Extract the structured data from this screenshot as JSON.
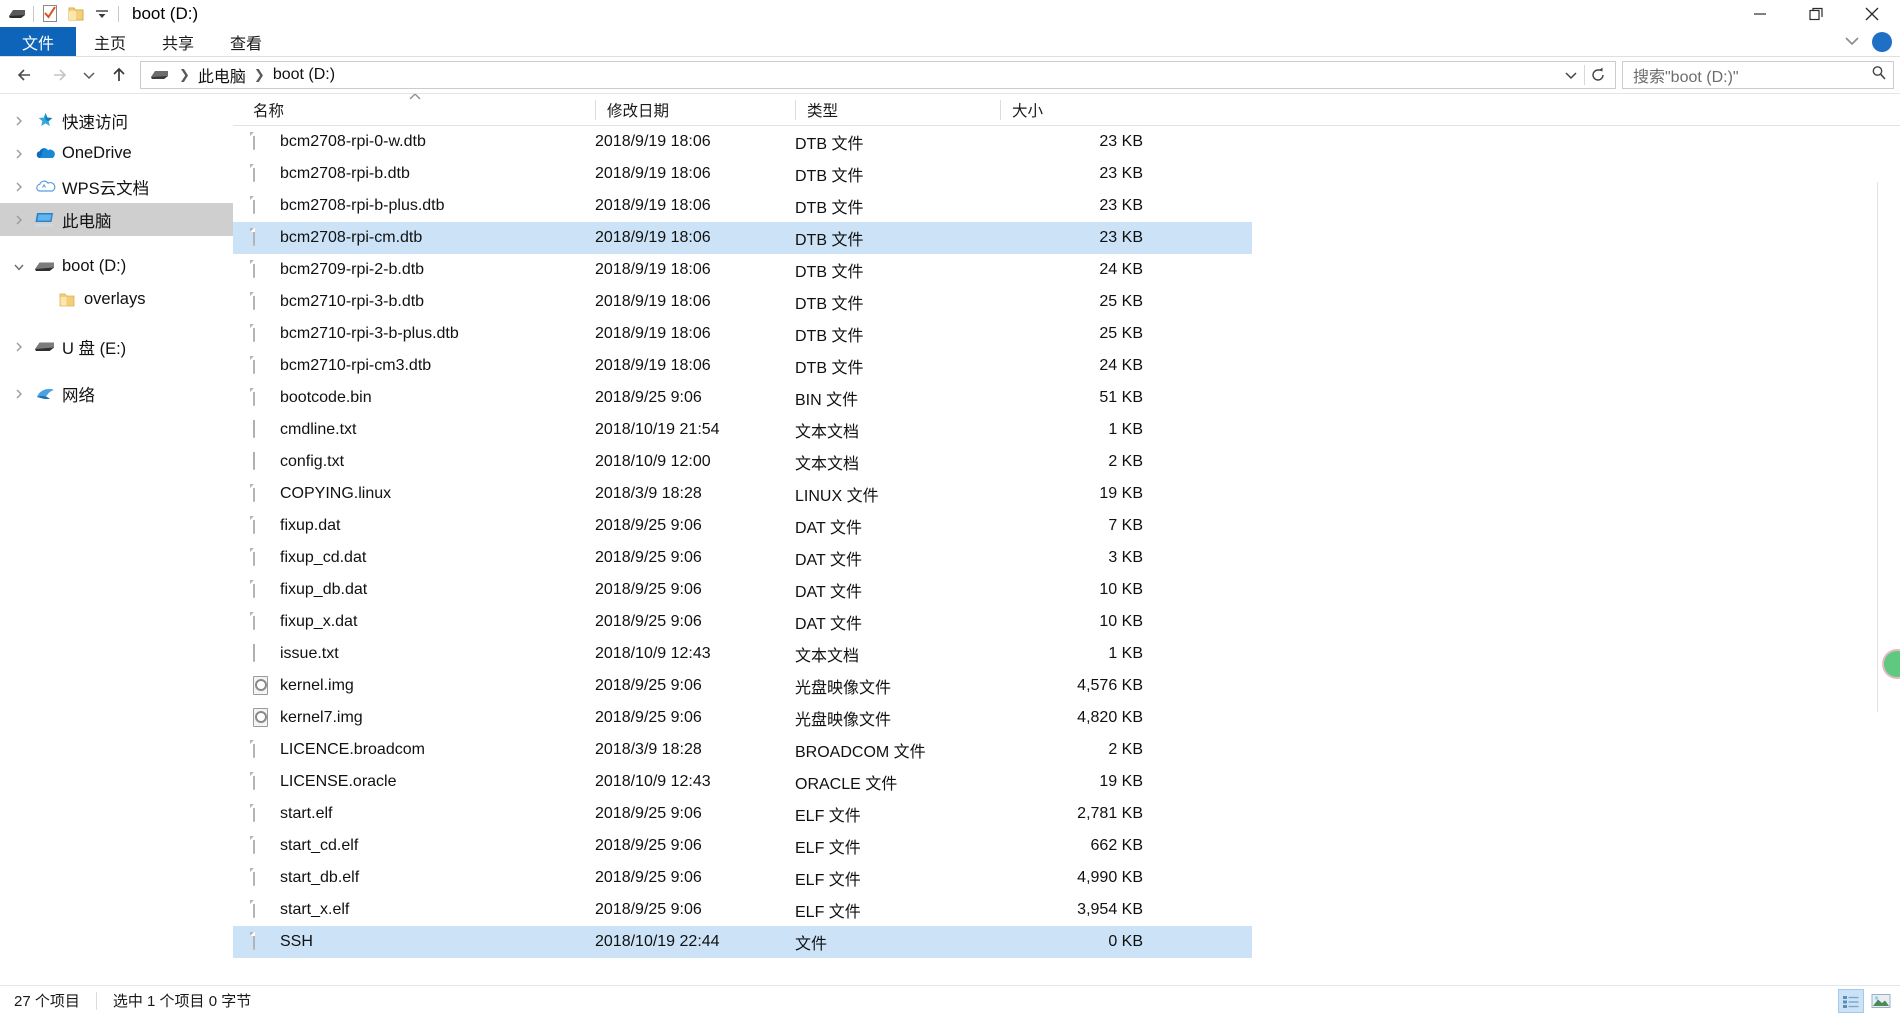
{
  "window": {
    "title": "boot (D:)",
    "quick_access_icons": [
      "drive-icon",
      "properties-icon",
      "new-folder-icon",
      "customize-dropdown-icon"
    ],
    "controls": {
      "minimize": "minimize-icon",
      "maximize": "maximize-icon",
      "close": "close-icon"
    }
  },
  "ribbon": {
    "tabs": [
      {
        "label": "文件",
        "active": true
      },
      {
        "label": "主页",
        "active": false
      },
      {
        "label": "共享",
        "active": false
      },
      {
        "label": "查看",
        "active": false
      }
    ],
    "collapse_icon": "chevron-down-icon",
    "help_icon": "help-circle-icon"
  },
  "address": {
    "back_icon": "arrow-left-icon",
    "forward_icon": "arrow-right-icon",
    "recent_icon": "chevron-down-icon",
    "up_icon": "arrow-up-icon",
    "drive_icon": "drive-icon",
    "breadcrumbs": [
      "此电脑",
      "boot (D:)"
    ],
    "dropdown_icon": "chevron-down-icon",
    "refresh_icon": "refresh-icon"
  },
  "search": {
    "placeholder": "搜索\"boot (D:)\"",
    "icon": "search-icon"
  },
  "sidebar": {
    "items": [
      {
        "label": "快速访问",
        "icon": "star-pin-icon",
        "expander": "chevron-right",
        "indent": 0,
        "selected": false
      },
      {
        "label": "OneDrive",
        "icon": "onedrive-cloud-icon",
        "expander": "chevron-right",
        "indent": 0,
        "selected": false
      },
      {
        "label": "WPS云文档",
        "icon": "wps-cloud-icon",
        "expander": "chevron-right",
        "indent": 0,
        "selected": false
      },
      {
        "label": "此电脑",
        "icon": "this-pc-icon",
        "expander": "chevron-right",
        "indent": 0,
        "selected": true
      },
      {
        "label": "boot (D:)",
        "icon": "drive-icon",
        "expander": "chevron-down",
        "indent": 0,
        "selected": false
      },
      {
        "label": "overlays",
        "icon": "folder-icon",
        "expander": "none",
        "indent": 1,
        "selected": false
      },
      {
        "label": "U 盘 (E:)",
        "icon": "drive-icon",
        "expander": "chevron-right",
        "indent": 0,
        "selected": false
      },
      {
        "label": "网络",
        "icon": "network-icon",
        "expander": "chevron-right",
        "indent": 0,
        "selected": false
      }
    ]
  },
  "file_list": {
    "columns": [
      "名称",
      "修改日期",
      "类型",
      "大小"
    ],
    "sort_column": "名称",
    "sort_direction": "ascending",
    "rows": [
      {
        "name": "bcm2708-rpi-0-w.dtb",
        "date": "2018/9/19 18:06",
        "type": "DTB 文件",
        "size": "23 KB",
        "icon": "file-icon",
        "selected": false
      },
      {
        "name": "bcm2708-rpi-b.dtb",
        "date": "2018/9/19 18:06",
        "type": "DTB 文件",
        "size": "23 KB",
        "icon": "file-icon",
        "selected": false
      },
      {
        "name": "bcm2708-rpi-b-plus.dtb",
        "date": "2018/9/19 18:06",
        "type": "DTB 文件",
        "size": "23 KB",
        "icon": "file-icon",
        "selected": false
      },
      {
        "name": "bcm2708-rpi-cm.dtb",
        "date": "2018/9/19 18:06",
        "type": "DTB 文件",
        "size": "23 KB",
        "icon": "file-icon",
        "selected": true
      },
      {
        "name": "bcm2709-rpi-2-b.dtb",
        "date": "2018/9/19 18:06",
        "type": "DTB 文件",
        "size": "24 KB",
        "icon": "file-icon",
        "selected": false
      },
      {
        "name": "bcm2710-rpi-3-b.dtb",
        "date": "2018/9/19 18:06",
        "type": "DTB 文件",
        "size": "25 KB",
        "icon": "file-icon",
        "selected": false
      },
      {
        "name": "bcm2710-rpi-3-b-plus.dtb",
        "date": "2018/9/19 18:06",
        "type": "DTB 文件",
        "size": "25 KB",
        "icon": "file-icon",
        "selected": false
      },
      {
        "name": "bcm2710-rpi-cm3.dtb",
        "date": "2018/9/19 18:06",
        "type": "DTB 文件",
        "size": "24 KB",
        "icon": "file-icon",
        "selected": false
      },
      {
        "name": "bootcode.bin",
        "date": "2018/9/25 9:06",
        "type": "BIN 文件",
        "size": "51 KB",
        "icon": "file-icon",
        "selected": false
      },
      {
        "name": "cmdline.txt",
        "date": "2018/10/19 21:54",
        "type": "文本文档",
        "size": "1 KB",
        "icon": "text-icon",
        "selected": false
      },
      {
        "name": "config.txt",
        "date": "2018/10/9 12:00",
        "type": "文本文档",
        "size": "2 KB",
        "icon": "text-icon",
        "selected": false
      },
      {
        "name": "COPYING.linux",
        "date": "2018/3/9 18:28",
        "type": "LINUX 文件",
        "size": "19 KB",
        "icon": "file-icon",
        "selected": false
      },
      {
        "name": "fixup.dat",
        "date": "2018/9/25 9:06",
        "type": "DAT 文件",
        "size": "7 KB",
        "icon": "file-icon",
        "selected": false
      },
      {
        "name": "fixup_cd.dat",
        "date": "2018/9/25 9:06",
        "type": "DAT 文件",
        "size": "3 KB",
        "icon": "file-icon",
        "selected": false
      },
      {
        "name": "fixup_db.dat",
        "date": "2018/9/25 9:06",
        "type": "DAT 文件",
        "size": "10 KB",
        "icon": "file-icon",
        "selected": false
      },
      {
        "name": "fixup_x.dat",
        "date": "2018/9/25 9:06",
        "type": "DAT 文件",
        "size": "10 KB",
        "icon": "file-icon",
        "selected": false
      },
      {
        "name": "issue.txt",
        "date": "2018/10/9 12:43",
        "type": "文本文档",
        "size": "1 KB",
        "icon": "text-icon",
        "selected": false
      },
      {
        "name": "kernel.img",
        "date": "2018/9/25 9:06",
        "type": "光盘映像文件",
        "size": "4,576 KB",
        "icon": "disc-image-icon",
        "selected": false
      },
      {
        "name": "kernel7.img",
        "date": "2018/9/25 9:06",
        "type": "光盘映像文件",
        "size": "4,820 KB",
        "icon": "disc-image-icon",
        "selected": false
      },
      {
        "name": "LICENCE.broadcom",
        "date": "2018/3/9 18:28",
        "type": "BROADCOM 文件",
        "size": "2 KB",
        "icon": "file-icon",
        "selected": false
      },
      {
        "name": "LICENSE.oracle",
        "date": "2018/10/9 12:43",
        "type": "ORACLE 文件",
        "size": "19 KB",
        "icon": "file-icon",
        "selected": false
      },
      {
        "name": "start.elf",
        "date": "2018/9/25 9:06",
        "type": "ELF 文件",
        "size": "2,781 KB",
        "icon": "file-icon",
        "selected": false
      },
      {
        "name": "start_cd.elf",
        "date": "2018/9/25 9:06",
        "type": "ELF 文件",
        "size": "662 KB",
        "icon": "file-icon",
        "selected": false
      },
      {
        "name": "start_db.elf",
        "date": "2018/9/25 9:06",
        "type": "ELF 文件",
        "size": "4,990 KB",
        "icon": "file-icon",
        "selected": false
      },
      {
        "name": "start_x.elf",
        "date": "2018/9/25 9:06",
        "type": "ELF 文件",
        "size": "3,954 KB",
        "icon": "file-icon",
        "selected": false
      },
      {
        "name": "SSH",
        "date": "2018/10/19 22:44",
        "type": "文件",
        "size": "0 KB",
        "icon": "file-icon",
        "selected": true
      }
    ]
  },
  "status": {
    "item_count": "27 个项目",
    "selection": "选中 1 个项目  0 字节",
    "view_buttons": [
      {
        "name": "details-view-button",
        "active": true
      },
      {
        "name": "large-icons-view-button",
        "active": false
      }
    ]
  },
  "colors": {
    "accent": "#0d64b9",
    "selection": "#cce3f7",
    "nav_selection": "#cfcfcf",
    "edge_badge": "#5fc97f"
  }
}
